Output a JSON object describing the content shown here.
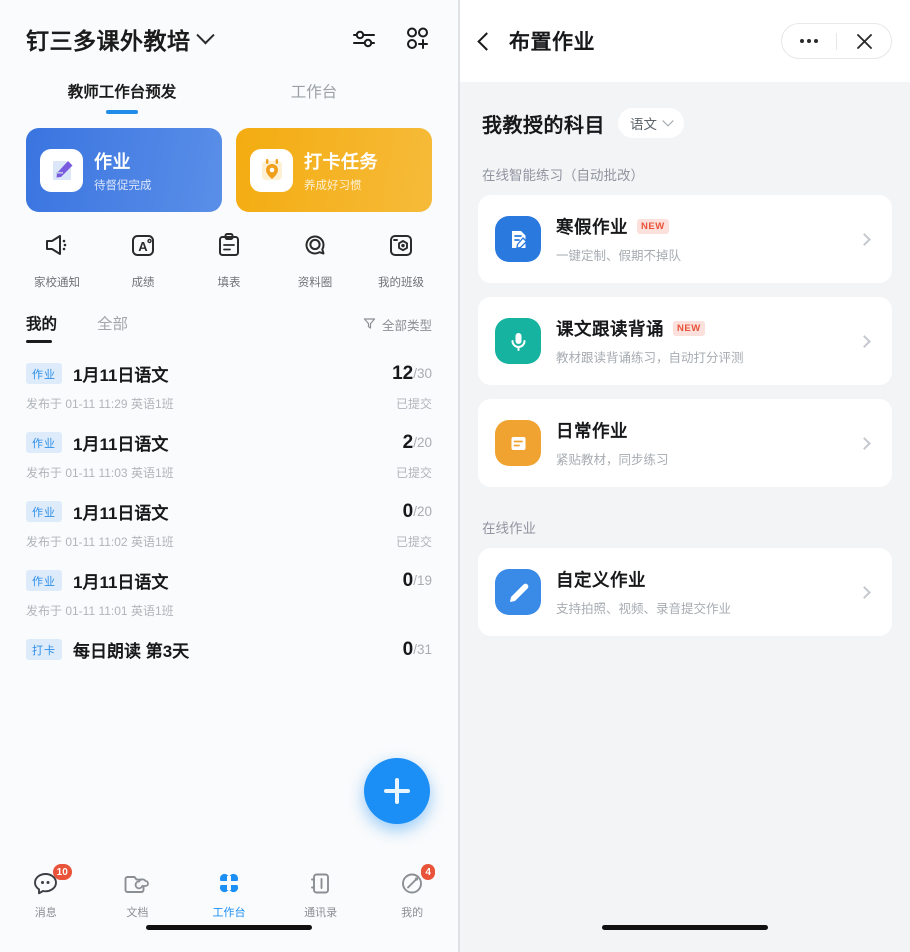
{
  "left": {
    "header": {
      "title": "钉三多课外教培",
      "chevron_icon": "chevron-down-icon",
      "filter_icon": "sliders-icon",
      "add_member_icon": "add-member-icon"
    },
    "tabs": [
      {
        "label": "教师工作台预发",
        "active": true
      },
      {
        "label": "工作台",
        "active": false
      }
    ],
    "banners": [
      {
        "title": "作业",
        "subtitle": "待督促完成",
        "color": "#3a74e0",
        "icon": "homework-pencil-icon"
      },
      {
        "title": "打卡任务",
        "subtitle": "养成好习惯",
        "color": "#f4ac10",
        "icon": "checkin-location-icon"
      }
    ],
    "quick_items": [
      {
        "label": "家校通知",
        "icon": "megaphone-icon"
      },
      {
        "label": "成绩",
        "icon": "grade-a-icon"
      },
      {
        "label": "填表",
        "icon": "clipboard-icon"
      },
      {
        "label": "资料圈",
        "icon": "circle-chat-icon"
      },
      {
        "label": "我的班级",
        "icon": "camera-class-icon"
      }
    ],
    "list_tabs": [
      {
        "label": "我的",
        "active": true
      },
      {
        "label": "全部",
        "active": false
      }
    ],
    "filter": {
      "label": "全部类型",
      "icon": "funnel-icon"
    },
    "homework": [
      {
        "badge": "作业",
        "title": "1月11日语文",
        "count": "12",
        "total": "/30",
        "meta": "发布于 01-11 11:29 英语1班",
        "status": "已提交"
      },
      {
        "badge": "作业",
        "title": "1月11日语文",
        "count": "2",
        "total": "/20",
        "meta": "发布于 01-11 11:03 英语1班",
        "status": "已提交"
      },
      {
        "badge": "作业",
        "title": "1月11日语文",
        "count": "0",
        "total": "/20",
        "meta": "发布于 01-11 11:02 英语1班",
        "status": "已提交"
      },
      {
        "badge": "作业",
        "title": "1月11日语文",
        "count": "0",
        "total": "/19",
        "meta": "发布于 01-11 11:01 英语1班",
        "status": ""
      },
      {
        "badge": "打卡",
        "title": "每日朗读 第3天",
        "count": "0",
        "total": "/31",
        "meta": "",
        "status": ""
      }
    ],
    "fab": {
      "icon": "plus-icon",
      "color": "#1b8ff5"
    },
    "bottom_nav": [
      {
        "label": "消息",
        "icon": "chat-bubble-icon",
        "badge": "10",
        "active": false
      },
      {
        "label": "文档",
        "icon": "folder-cloud-icon",
        "badge": "",
        "active": false
      },
      {
        "label": "工作台",
        "icon": "grid-four-icon",
        "badge": "",
        "active": true
      },
      {
        "label": "通讯录",
        "icon": "contacts-icon",
        "badge": "",
        "active": false
      },
      {
        "label": "我的",
        "icon": "compass-icon",
        "badge": "4",
        "active": false
      }
    ]
  },
  "right": {
    "header": {
      "title": "布置作业",
      "back_icon": "back-chevron-icon",
      "more_icon": "more-dots-icon",
      "close_icon": "close-icon"
    },
    "subject": {
      "label": "我教授的科目",
      "value": "语文",
      "chevron_icon": "chevron-down-icon"
    },
    "sections": [
      {
        "title": "在线智能练习（自动批改）",
        "items": [
          {
            "title": "寒假作业",
            "badge": "NEW",
            "subtitle": "一键定制、假期不掉队",
            "icon": "doc-pencil-icon",
            "color": "#2979de"
          },
          {
            "title": "课文跟读背诵",
            "badge": "NEW",
            "subtitle": "教材跟读背诵练习，自动打分评测",
            "icon": "microphone-icon",
            "color": "#16b3a0"
          },
          {
            "title": "日常作业",
            "badge": "",
            "subtitle": "紧贴教材，同步练习",
            "icon": "document-lines-icon",
            "color": "#f0a330"
          }
        ]
      },
      {
        "title": "在线作业",
        "items": [
          {
            "title": "自定义作业",
            "badge": "",
            "subtitle": "支持拍照、视频、录音提交作业",
            "icon": "pencil-icon",
            "color": "#3a8ae8"
          }
        ]
      }
    ]
  }
}
